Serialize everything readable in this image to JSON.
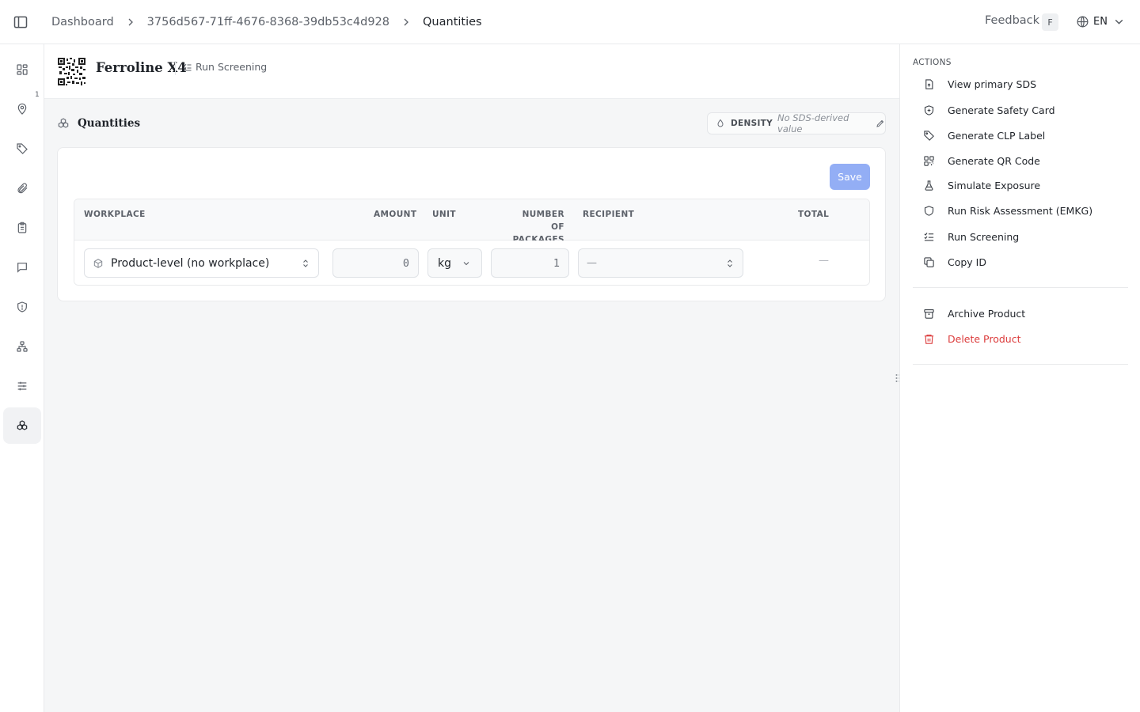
{
  "breadcrumb": {
    "items": [
      "Dashboard",
      "3756d567-71ff-4676-8368-39db53c4d928",
      "Quantities"
    ]
  },
  "topbar": {
    "feedback_label": "Feedback",
    "feedback_shortcut": "F",
    "language": "EN"
  },
  "sidebar": {
    "badge": "1",
    "items": [
      {
        "icon": "dashboard-grid-icon"
      },
      {
        "icon": "map-pin-icon"
      },
      {
        "icon": "tag-icon"
      },
      {
        "icon": "paperclip-icon"
      },
      {
        "icon": "clipboard-icon"
      },
      {
        "icon": "message-icon"
      },
      {
        "icon": "shield-alert-icon"
      },
      {
        "icon": "network-icon"
      },
      {
        "icon": "sliders-icon"
      },
      {
        "icon": "boxes-icon",
        "active": true
      }
    ]
  },
  "product": {
    "name": "Ferroline X4",
    "run_screening_label": "Run Screening"
  },
  "quantities": {
    "title": "Quantities",
    "density_label": "DENSITY",
    "density_value": "No SDS-derived value",
    "save_label": "Save",
    "columns": {
      "workplace": "WORKPLACE",
      "amount": "AMOUNT",
      "unit": "UNIT",
      "packages_line1": "NUMBER OF",
      "packages_line2": "PACKAGES",
      "recipient": "RECIPIENT",
      "total": "TOTAL"
    },
    "row": {
      "workplace": "Product-level (no workplace)",
      "amount": "0",
      "unit": "kg",
      "packages": "1",
      "recipient": "—",
      "total": "—"
    }
  },
  "actions": {
    "title": "ACTIONS",
    "items": [
      {
        "label": "View primary SDS",
        "icon": "file-upload-icon"
      },
      {
        "label": "Generate Safety Card",
        "icon": "shield-plus-icon"
      },
      {
        "label": "Generate CLP Label",
        "icon": "tag-icon"
      },
      {
        "label": "Generate QR Code",
        "icon": "qr-code-icon"
      },
      {
        "label": "Simulate Exposure",
        "icon": "flask-icon"
      },
      {
        "label": "Run Risk Assessment (EMKG)",
        "icon": "shield-icon"
      },
      {
        "label": "Run Screening",
        "icon": "list-checks-icon"
      },
      {
        "label": "Copy ID",
        "icon": "copy-icon"
      }
    ],
    "secondary": [
      {
        "label": "Archive Product",
        "icon": "archive-icon"
      },
      {
        "label": "Delete Product",
        "icon": "trash-icon",
        "color": "#dc3c3c"
      }
    ]
  },
  "colors": {
    "accent": "#93aef5",
    "danger": "#dc3c3c"
  }
}
